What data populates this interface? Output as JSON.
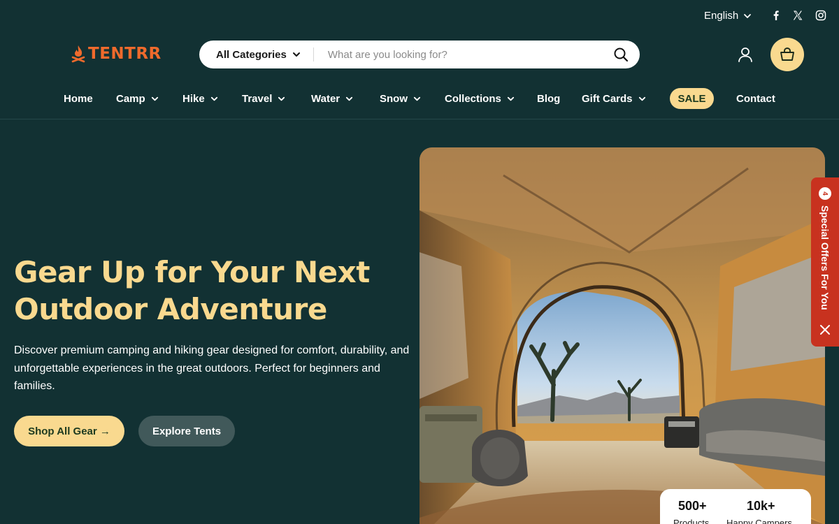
{
  "topbar": {
    "language": "English",
    "social_icons": [
      "facebook-icon",
      "x-icon",
      "instagram-icon"
    ]
  },
  "header": {
    "logo_text": "TENTRR",
    "search": {
      "category_label": "All Categories",
      "placeholder": "What are you looking for?"
    }
  },
  "nav": {
    "items": [
      {
        "label": "Home",
        "dropdown": false
      },
      {
        "label": "Camp",
        "dropdown": true
      },
      {
        "label": "Hike",
        "dropdown": true
      },
      {
        "label": "Travel",
        "dropdown": true
      },
      {
        "label": "Water",
        "dropdown": true
      },
      {
        "label": "Snow",
        "dropdown": true
      },
      {
        "label": "Collections",
        "dropdown": true
      },
      {
        "label": "Blog",
        "dropdown": false
      },
      {
        "label": "Gift Cards",
        "dropdown": true
      },
      {
        "label": "SALE",
        "dropdown": false
      },
      {
        "label": "Contact",
        "dropdown": false
      }
    ]
  },
  "hero": {
    "title": "Gear Up for Your Next Outdoor Adventure",
    "description": "Discover premium camping and hiking gear designed for comfort, durability, and unforgettable experiences in the great outdoors. Perfect for beginners and families.",
    "primary_button": "Shop All Gear →",
    "secondary_button": "Explore Tents"
  },
  "stats": [
    {
      "value": "500+",
      "label": "Products"
    },
    {
      "value": "10k+",
      "label": "Happy Campers"
    }
  ],
  "offers_tab": {
    "badge": "4",
    "label": "Special Offers For You"
  },
  "colors": {
    "background": "#123133",
    "accent": "#f9d98f",
    "brand": "#ef6a2c",
    "offers": "#c8321f"
  }
}
